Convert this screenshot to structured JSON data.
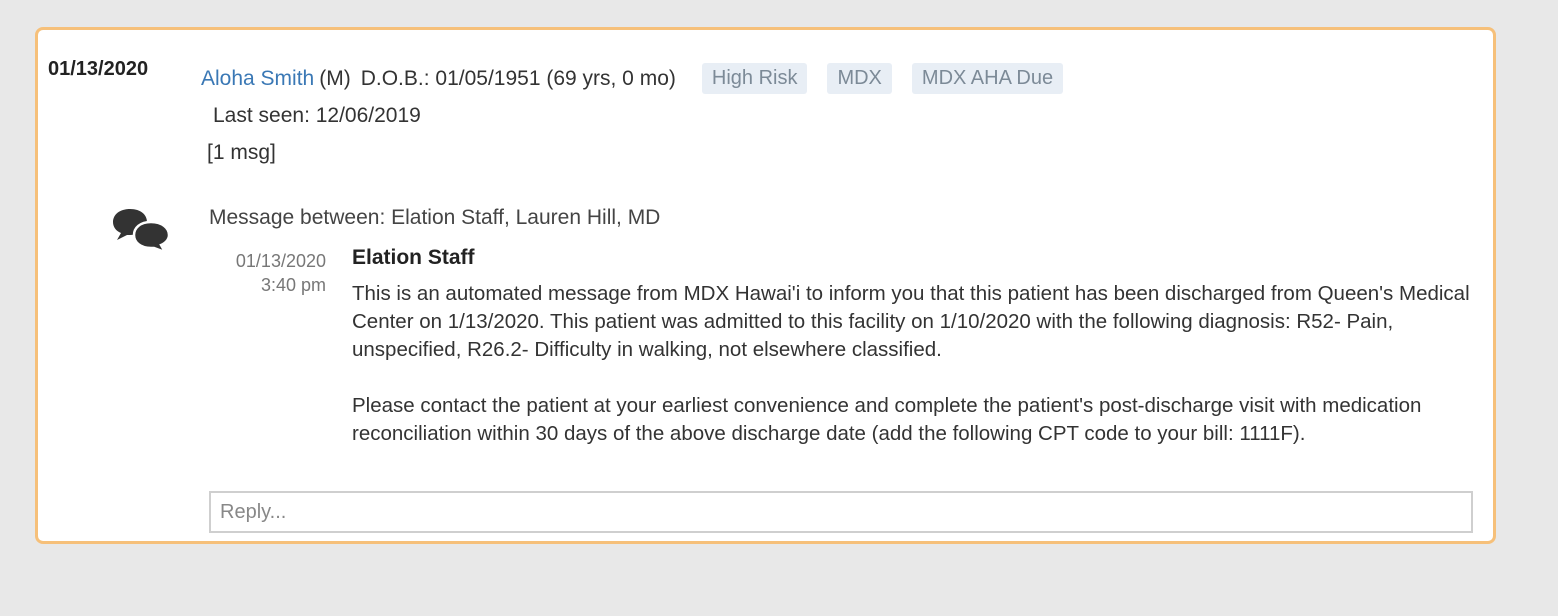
{
  "entry": {
    "date": "01/13/2020",
    "patient": {
      "name": "Aloha Smith",
      "gender": "(M)",
      "dob": "D.O.B.: 01/05/1951 (69 yrs, 0 mo)"
    },
    "tags": [
      "High Risk",
      "MDX",
      "MDX AHA Due"
    ],
    "last_seen": "Last seen: 12/06/2019",
    "message_count": "[1 msg]"
  },
  "thread": {
    "icon": "chat-bubbles-icon",
    "participants": "Message between: Elation Staff, Lauren Hill, MD",
    "messages": [
      {
        "date": "01/13/2020",
        "time": "3:40 pm",
        "sender": "Elation Staff",
        "paragraphs": [
          "This is an automated message from MDX Hawai'i to inform you that this patient has been discharged from Queen's Medical Center on 1/13/2020. This patient was admitted to this facility on 1/10/2020 with the following diagnosis: R52- Pain, unspecified, R26.2- Difficulty in walking, not elsewhere classified.",
          "Please contact the patient at your earliest convenience and complete the patient's post-discharge visit with medication reconciliation within 30 days of the above discharge date (add the following CPT code to your bill: 1111F)."
        ]
      }
    ],
    "reply_placeholder": "Reply..."
  },
  "colors": {
    "card_border": "#f6c07a",
    "link": "#3a78b5",
    "tag_bg": "#e8eef5",
    "tag_text": "#7c8a97",
    "page_bg": "#e8e8e8"
  }
}
